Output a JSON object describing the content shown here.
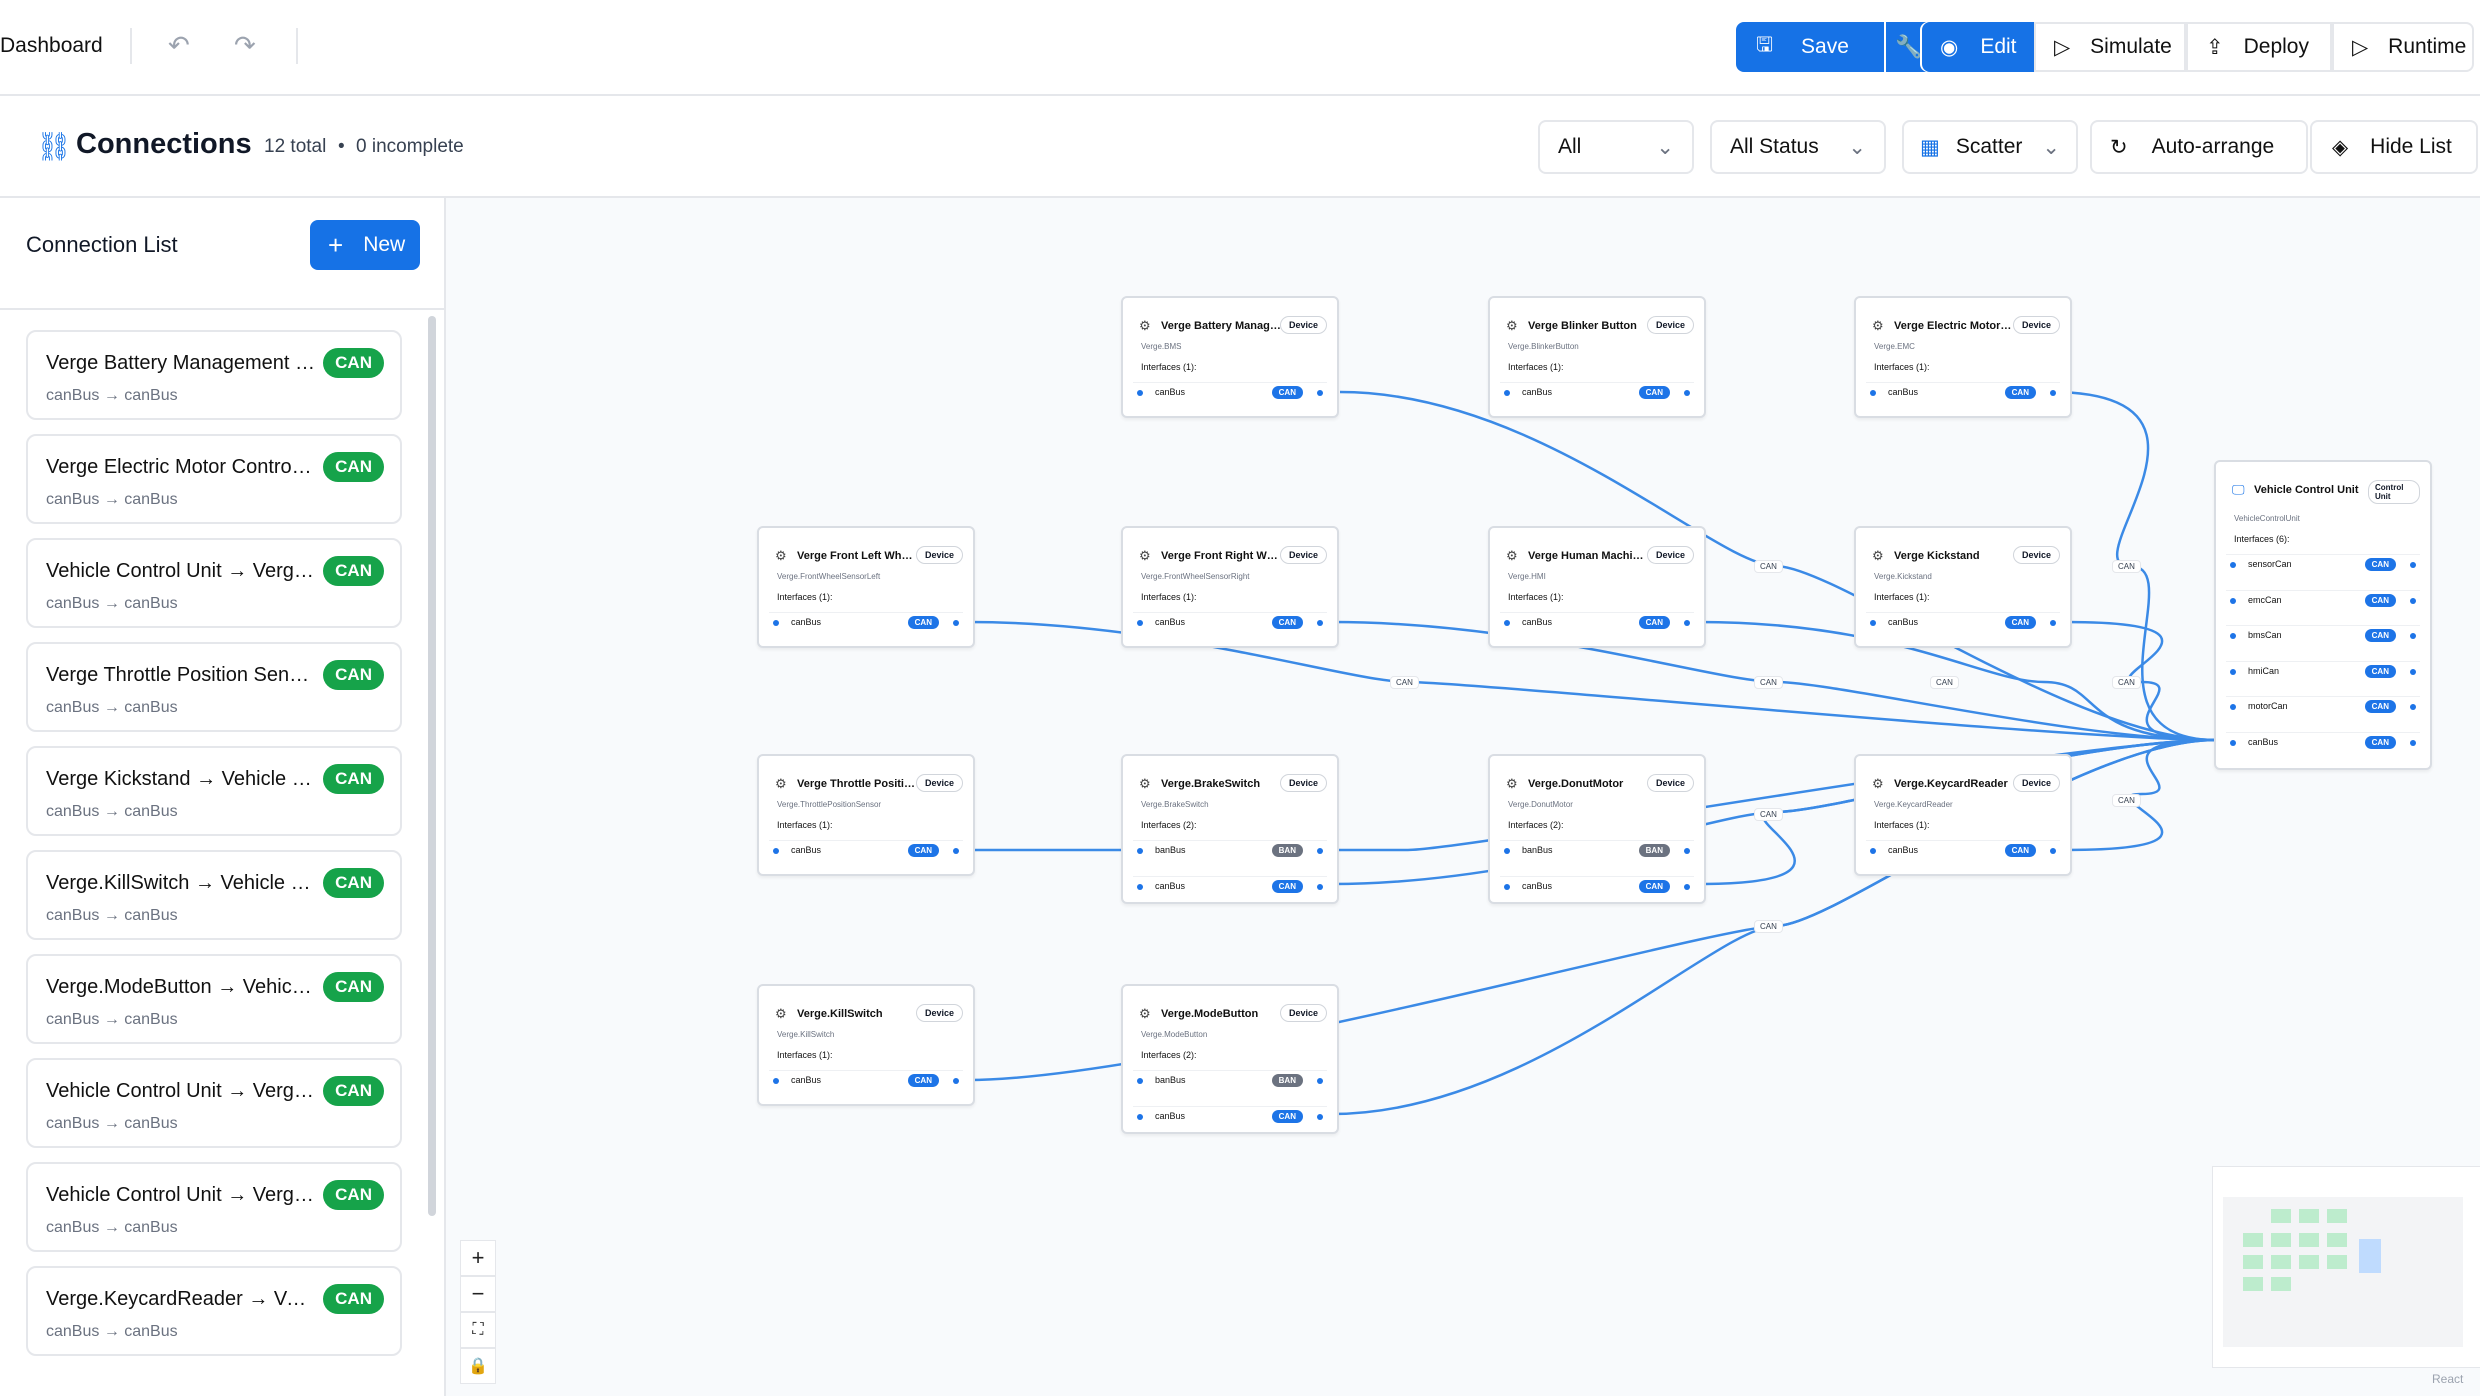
{
  "topbar": {
    "dashboard": "Dashboard",
    "save": "Save",
    "edit": "Edit",
    "simulate": "Simulate",
    "deploy": "Deploy",
    "runtime": "Runtime"
  },
  "header": {
    "title": "Connections",
    "total": "12 total",
    "separator": "•",
    "incomplete": "0 incomplete",
    "filter_type": "All",
    "filter_status": "All Status",
    "layout": "Scatter",
    "auto_arrange": "Auto-arrange",
    "hide_list": "Hide List"
  },
  "sidebar": {
    "title": "Connection List",
    "new_label": "New",
    "items": [
      {
        "title": "Verge Battery Management S...",
        "sub": "canBus → canBus",
        "badge": "CAN"
      },
      {
        "title": "Verge Electric Motor Controlle...",
        "sub": "canBus → canBus",
        "badge": "CAN"
      },
      {
        "title": "Vehicle Control Unit → Verge ...",
        "sub": "canBus → canBus",
        "badge": "CAN"
      },
      {
        "title": "Verge Throttle Position Senso...",
        "sub": "canBus → canBus",
        "badge": "CAN"
      },
      {
        "title": "Verge Kickstand → Vehicle C...",
        "sub": "canBus → canBus",
        "badge": "CAN"
      },
      {
        "title": "Verge.KillSwitch → Vehicle C...",
        "sub": "canBus → canBus",
        "badge": "CAN"
      },
      {
        "title": "Verge.ModeButton → Vehicle ...",
        "sub": "canBus → canBus",
        "badge": "CAN"
      },
      {
        "title": "Vehicle Control Unit → Verge...",
        "sub": "canBus → canBus",
        "badge": "CAN"
      },
      {
        "title": "Vehicle Control Unit → Verge...",
        "sub": "canBus → canBus",
        "badge": "CAN"
      },
      {
        "title": "Verge.KeycardReader → Vehi...",
        "sub": "canBus → canBus",
        "badge": "CAN"
      }
    ]
  },
  "canvas": {
    "device_tag": "Device",
    "control_tag": "Control Unit",
    "edge_label": "CAN",
    "attribution": "React",
    "nodes": [
      {
        "title": "Verge Battery Manage...",
        "id": "Verge.BMS",
        "ifaces": "Interfaces (1):",
        "rows": [
          {
            "name": "canBus",
            "pill": "CAN"
          }
        ]
      },
      {
        "title": "Verge Blinker Button",
        "id": "Verge.BlinkerButton",
        "ifaces": "Interfaces (1):",
        "rows": [
          {
            "name": "canBus",
            "pill": "CAN"
          }
        ]
      },
      {
        "title": "Verge Electric Motor C...",
        "id": "Verge.EMC",
        "ifaces": "Interfaces (1):",
        "rows": [
          {
            "name": "canBus",
            "pill": "CAN"
          }
        ]
      },
      {
        "title": "Verge Front Left Wheel...",
        "id": "Verge.FrontWheelSensorLeft",
        "ifaces": "Interfaces (1):",
        "rows": [
          {
            "name": "canBus",
            "pill": "CAN"
          }
        ]
      },
      {
        "title": "Verge Front Right Whe...",
        "id": "Verge.FrontWheelSensorRight",
        "ifaces": "Interfaces (1):",
        "rows": [
          {
            "name": "canBus",
            "pill": "CAN"
          }
        ]
      },
      {
        "title": "Verge Human Machine...",
        "id": "Verge.HMI",
        "ifaces": "Interfaces (1):",
        "rows": [
          {
            "name": "canBus",
            "pill": "CAN"
          }
        ]
      },
      {
        "title": "Verge Kickstand",
        "id": "Verge.Kickstand",
        "ifaces": "Interfaces (1):",
        "rows": [
          {
            "name": "canBus",
            "pill": "CAN"
          }
        ]
      },
      {
        "title": "Verge Throttle Position...",
        "id": "Verge.ThrottlePositionSensor",
        "ifaces": "Interfaces (1):",
        "rows": [
          {
            "name": "canBus",
            "pill": "CAN"
          }
        ]
      },
      {
        "title": "Verge.BrakeSwitch",
        "id": "Verge.BrakeSwitch",
        "ifaces": "Interfaces (2):",
        "rows": [
          {
            "name": "banBus",
            "pill": "BAN"
          },
          {
            "name": "canBus",
            "pill": "CAN"
          }
        ]
      },
      {
        "title": "Verge.DonutMotor",
        "id": "Verge.DonutMotor",
        "ifaces": "Interfaces (2):",
        "rows": [
          {
            "name": "banBus",
            "pill": "BAN"
          },
          {
            "name": "canBus",
            "pill": "CAN"
          }
        ]
      },
      {
        "title": "Verge.KeycardReader",
        "id": "Verge.KeycardReader",
        "ifaces": "Interfaces (1):",
        "rows": [
          {
            "name": "canBus",
            "pill": "CAN"
          }
        ]
      },
      {
        "title": "Verge.KillSwitch",
        "id": "Verge.KillSwitch",
        "ifaces": "Interfaces (1):",
        "rows": [
          {
            "name": "canBus",
            "pill": "CAN"
          }
        ]
      },
      {
        "title": "Verge.ModeButton",
        "id": "Verge.ModeButton",
        "ifaces": "Interfaces (2):",
        "rows": [
          {
            "name": "banBus",
            "pill": "BAN"
          },
          {
            "name": "canBus",
            "pill": "CAN"
          }
        ]
      }
    ],
    "vcu": {
      "title": "Vehicle Control Unit",
      "id": "VehicleControlUnit",
      "ifaces": "Interfaces (6):",
      "rows": [
        {
          "name": "sensorCan",
          "pill": "CAN"
        },
        {
          "name": "emcCan",
          "pill": "CAN"
        },
        {
          "name": "bmsCan",
          "pill": "CAN"
        },
        {
          "name": "hmiCan",
          "pill": "CAN"
        },
        {
          "name": "motorCan",
          "pill": "CAN"
        },
        {
          "name": "canBus",
          "pill": "CAN"
        }
      ]
    }
  },
  "colors": {
    "primary": "#1672e6",
    "can_badge": "#16a34a",
    "edge": "#3b8ae6"
  }
}
